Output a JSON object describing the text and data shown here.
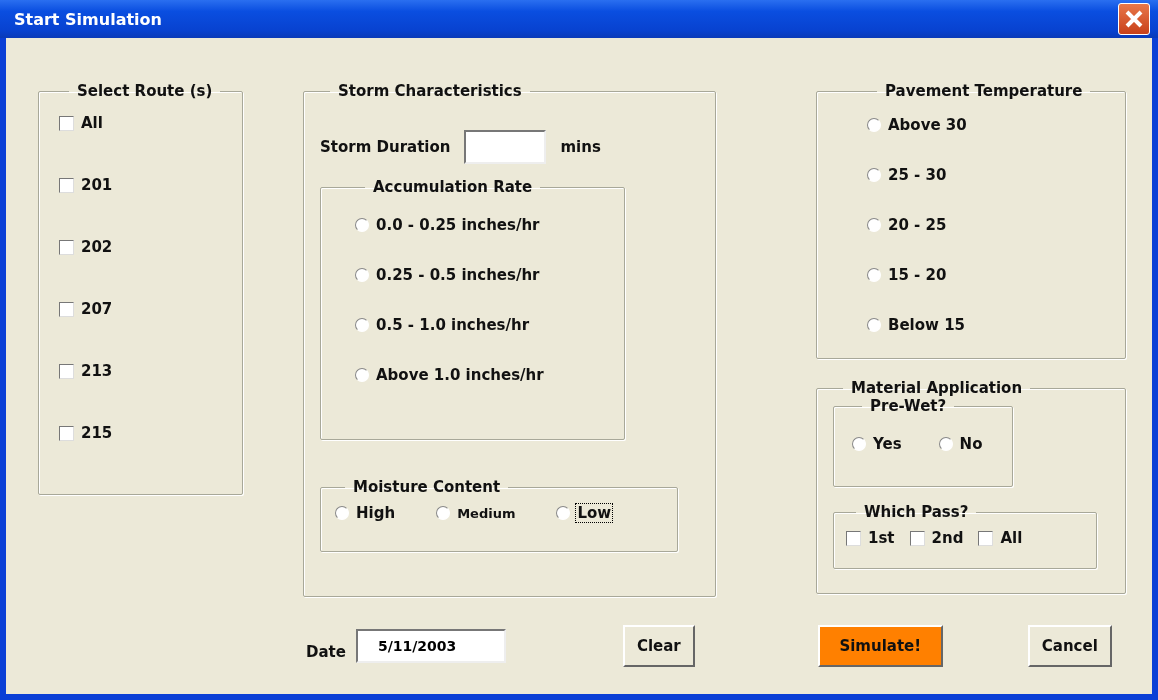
{
  "window": {
    "title": "Start Simulation"
  },
  "routes": {
    "title": "Select Route (s)",
    "items": [
      {
        "label": "All",
        "checked": false
      },
      {
        "label": "201",
        "checked": false
      },
      {
        "label": "202",
        "checked": false
      },
      {
        "label": "207",
        "checked": false
      },
      {
        "label": "213",
        "checked": false
      },
      {
        "label": "215",
        "checked": false
      }
    ]
  },
  "storm": {
    "title": "Storm Characteristics",
    "duration_label": "Storm Duration",
    "duration_unit": "mins",
    "accumulation": {
      "title": "Accumulation Rate",
      "options": [
        {
          "label": "0.0 - 0.25 inches/hr",
          "selected": false
        },
        {
          "label": "0.25 - 0.5 inches/hr",
          "selected": false
        },
        {
          "label": "0.5 - 1.0 inches/hr",
          "selected": false
        },
        {
          "label": "Above 1.0 inches/hr",
          "selected": false
        }
      ]
    },
    "moisture": {
      "title": "Moisture Content",
      "options": [
        {
          "label": "High",
          "selected": false,
          "focused": false
        },
        {
          "label": "Medium",
          "selected": false,
          "focused": false
        },
        {
          "label": "Low",
          "selected": false,
          "focused": true
        }
      ]
    }
  },
  "pavement": {
    "title": "Pavement Temperature",
    "options": [
      {
        "label": "Above 30",
        "selected": false
      },
      {
        "label": "25 - 30",
        "selected": false
      },
      {
        "label": "20 - 25",
        "selected": false
      },
      {
        "label": "15 - 20",
        "selected": false
      },
      {
        "label": "Below 15",
        "selected": false
      }
    ]
  },
  "material": {
    "title": "Material Application",
    "prewet": {
      "title": "Pre-Wet?",
      "options": [
        {
          "label": "Yes",
          "selected": false
        },
        {
          "label": "No",
          "selected": false
        }
      ]
    },
    "pass": {
      "title": "Which Pass?",
      "items": [
        {
          "label": "1st",
          "checked": false
        },
        {
          "label": "2nd",
          "checked": false
        },
        {
          "label": "All",
          "checked": false
        }
      ]
    }
  },
  "date": {
    "label": "Date",
    "value": "5/11/2003"
  },
  "buttons": [
    {
      "label": "Clear",
      "kind": "normal"
    },
    {
      "label": "Simulate!",
      "kind": "primary"
    },
    {
      "label": "Cancel",
      "kind": "normal"
    }
  ]
}
